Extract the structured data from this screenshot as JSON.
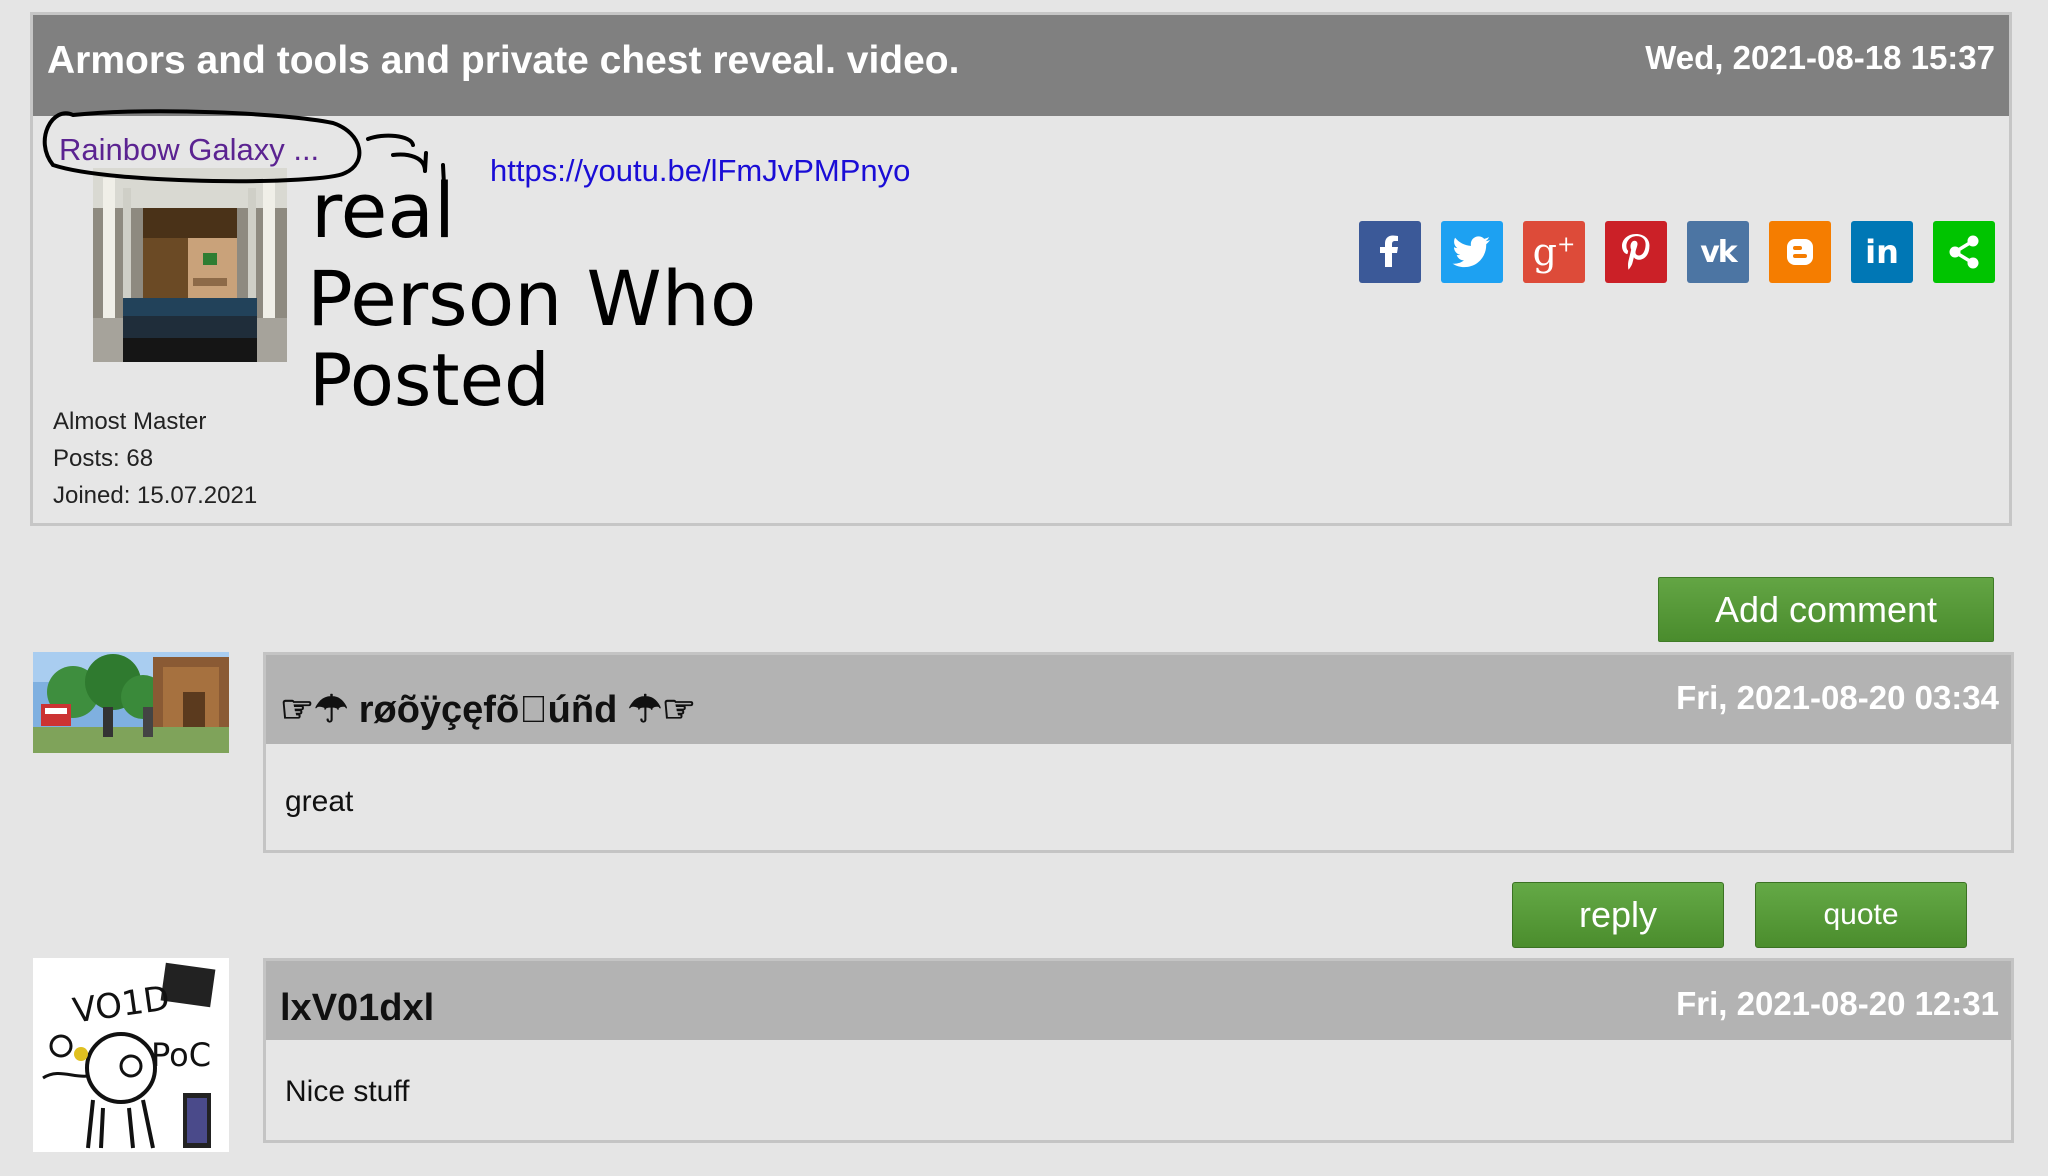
{
  "post": {
    "title": "Armors and tools and private chest reveal. video.",
    "date": "Wed, 2021-08-18 15:37",
    "author": {
      "name": "Rainbow Galaxy ...",
      "rank": "Almost Master",
      "posts": "Posts: 68",
      "joined": "Joined: 15.07.2021"
    },
    "link": "https://youtu.be/lFmJvPMPnyo",
    "annotation_text": [
      "real",
      "Person Who",
      "Posted"
    ]
  },
  "share": [
    {
      "icon": "facebook-icon",
      "color": "#3b5998"
    },
    {
      "icon": "twitter-icon",
      "color": "#1da1f2"
    },
    {
      "icon": "google-plus-icon",
      "color": "#dd4b39"
    },
    {
      "icon": "pinterest-icon",
      "color": "#cb2027"
    },
    {
      "icon": "vk-icon",
      "color": "#4c75a3"
    },
    {
      "icon": "blogger-icon",
      "color": "#f57d00"
    },
    {
      "icon": "linkedin-icon",
      "color": "#0077b5"
    },
    {
      "icon": "share-icon",
      "color": "#00c400"
    }
  ],
  "add_comment_label": "Add comment",
  "comments": [
    {
      "author": "☞☂ røõÿçęfõ􀀀úñd ☂☞",
      "date": "Fri, 2021-08-20 03:34",
      "body": "great"
    },
    {
      "author": "lxV01dxl",
      "date": "Fri, 2021-08-20 12:31",
      "body": "Nice stuff"
    }
  ],
  "actions": {
    "reply_label": "reply",
    "quote_label": "quote"
  },
  "colors": {
    "header_gray": "#808080",
    "comment_head_gray": "#b3b3b3",
    "button_green": "#5a9b3c",
    "link_blue": "#1a0dd6",
    "author_purple": "#5b2391"
  }
}
